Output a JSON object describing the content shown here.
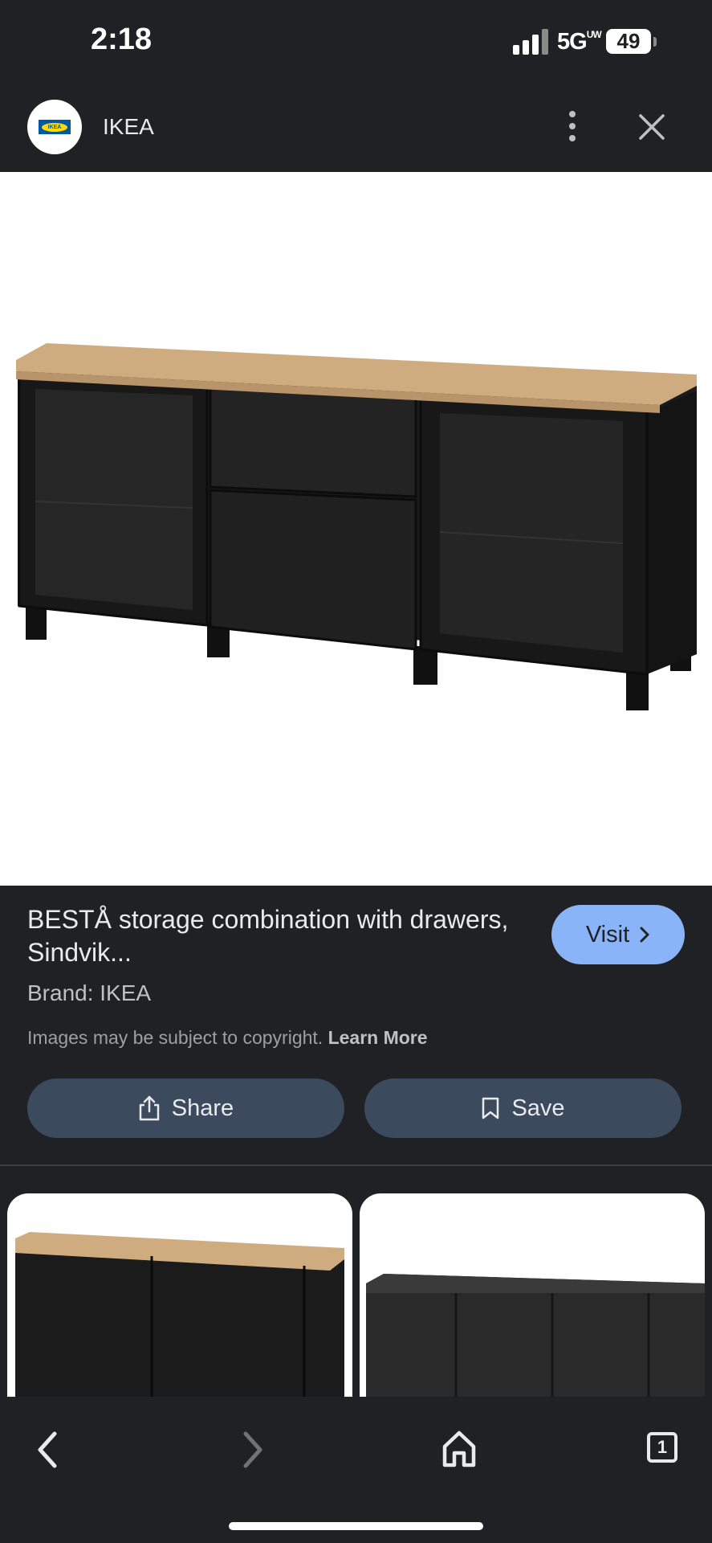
{
  "status_bar": {
    "time": "2:18",
    "network": "5G",
    "network_suffix": "UW",
    "battery": "49"
  },
  "toolbar": {
    "site_name": "IKEA",
    "logo_text": "IKEA",
    "more_icon": "more-vert-icon",
    "close_icon": "close-icon"
  },
  "product": {
    "title": "BESTÅ storage combination with drawers, Sindvik...",
    "brand": "Brand: IKEA",
    "visit_label": "Visit",
    "copyright_text": "Images may be subject to copyright.",
    "learn_more": "Learn More"
  },
  "actions": {
    "share_label": "Share",
    "save_label": "Save"
  },
  "bottom_nav": {
    "tab_count": "1"
  },
  "colors": {
    "background": "#202124",
    "accent": "#8ab4f8",
    "action_button": "#3c4a5e"
  }
}
